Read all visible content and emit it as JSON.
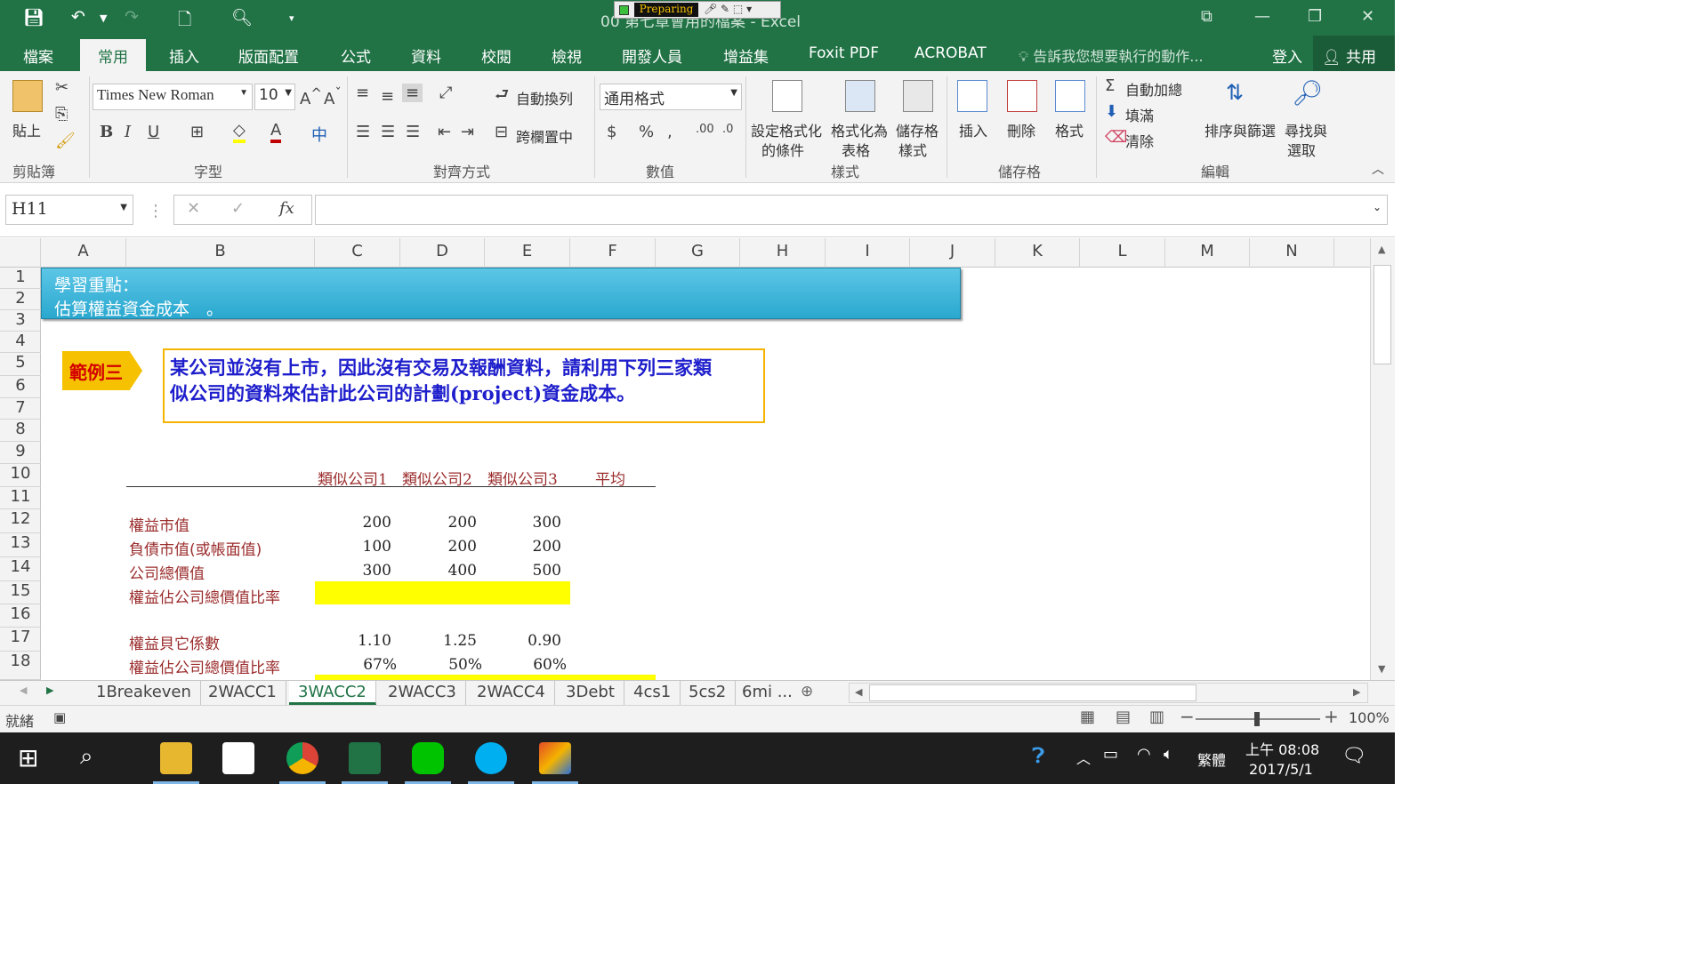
{
  "window": {
    "title": "00 第七章會用的檔案 - Excel",
    "preparing": "Preparing"
  },
  "ribbon_tabs": [
    "檔案",
    "常用",
    "插入",
    "版面配置",
    "公式",
    "資料",
    "校閱",
    "檢視",
    "開發人員",
    "增益集",
    "Foxit PDF",
    "ACROBAT"
  ],
  "tell_me": "告訴我您想要執行的動作...",
  "login": "登入",
  "share": "共用",
  "ribbon": {
    "clipboard": {
      "paste": "貼上",
      "label": "剪貼簿"
    },
    "font": {
      "name": "Times New Roman",
      "size": "10",
      "label": "字型"
    },
    "alignment": {
      "wrap": "自動換列",
      "merge": "跨欄置中",
      "label": "對齊方式"
    },
    "number": {
      "format": "通用格式",
      "label": "數值"
    },
    "styles": {
      "cond": "設定格式化的條件",
      "cond1": "設定格式化",
      "cond2": "的條件",
      "table1": "格式化為",
      "table2": "表格",
      "cell1": "儲存格",
      "cell2": "樣式",
      "label": "樣式"
    },
    "cells": {
      "insert": "插入",
      "delete": "刪除",
      "format": "格式",
      "label": "儲存格"
    },
    "editing": {
      "autosum": "自動加總",
      "fill": "填滿",
      "clear": "清除",
      "sort": "排序與篩選",
      "find1": "尋找與",
      "find2": "選取",
      "label": "編輯"
    }
  },
  "formula_bar": {
    "name_box": "H11",
    "fx": "fx",
    "formula": ""
  },
  "columns": [
    "A",
    "B",
    "C",
    "D",
    "E",
    "F",
    "G",
    "H",
    "I",
    "J",
    "K",
    "L",
    "M",
    "N"
  ],
  "rows": [
    "1",
    "2",
    "3",
    "4",
    "5",
    "6",
    "7",
    "8",
    "9",
    "10",
    "11",
    "12",
    "13",
    "14",
    "15",
    "16",
    "17",
    "18"
  ],
  "sheet": {
    "banner_line1": "學習重點：",
    "banner_line2": "估算權益資金成本　。",
    "example_tag": "範例三",
    "problem_line1": "某公司並沒有上市，因此沒有交易及報酬資料，請利用下列三家類",
    "problem_line2": "似公司的資料來估計此公司的計劃(project)資金成本。",
    "headers": [
      "類似公司1",
      "類似公司2",
      "類似公司3",
      "平均"
    ],
    "table": [
      {
        "label": "權益市值",
        "values": [
          "200",
          "200",
          "300"
        ]
      },
      {
        "label": "負債市值(或帳面值)",
        "values": [
          "100",
          "200",
          "200"
        ]
      },
      {
        "label": "公司總價值",
        "values": [
          "300",
          "400",
          "500"
        ]
      },
      {
        "label": "權益佔公司總價值比率",
        "values": [
          "",
          "",
          ""
        ]
      },
      {
        "label": "權益貝它係數",
        "values": [
          "1.10",
          "1.25",
          "0.90"
        ]
      },
      {
        "label": "權益佔公司總價值比率",
        "values": [
          "67%",
          "50%",
          "60%"
        ]
      }
    ]
  },
  "sheet_tabs": [
    "1Breakeven",
    "2WACC1",
    "3WACC2",
    "2WACC3",
    "2WACC4",
    "3Debt",
    "4cs1",
    "5cs2",
    "6mi ..."
  ],
  "active_sheet": "3WACC2",
  "status": {
    "ready": "就緒",
    "zoom": "100%"
  },
  "taskbar": {
    "time": "上午 08:08",
    "date": "2017/5/1",
    "ime": "繁體"
  },
  "colors": {
    "excel_green": "#217346",
    "banner": "#2aa8cf",
    "highlight": "#ffff00",
    "example_tag": "#f5c100"
  }
}
